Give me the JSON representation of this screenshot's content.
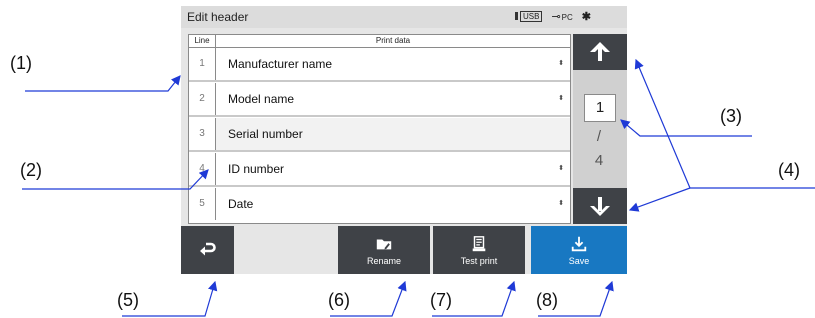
{
  "window": {
    "title": "Edit header"
  },
  "status_icons": {
    "usb_label": "USB",
    "pc_label": "PC",
    "bluetooth_glyph": "✱",
    "icons": [
      "usb-icon",
      "pc-connection-icon",
      "bluetooth-icon"
    ]
  },
  "table": {
    "headers": {
      "line": "Line",
      "data": "Print data"
    },
    "rows": [
      {
        "line": "1",
        "value": "Manufacturer name",
        "marker": "⬍"
      },
      {
        "line": "2",
        "value": "Model name",
        "marker": "⬍"
      },
      {
        "line": "3",
        "value": "Serial number",
        "marker": ""
      },
      {
        "line": "4",
        "value": "ID number",
        "marker": "⬍"
      },
      {
        "line": "5",
        "value": "Date",
        "marker": "⬍"
      }
    ]
  },
  "pager": {
    "current": "1",
    "separator": "/",
    "total": "4"
  },
  "toolbar": {
    "back_icon": "return-arrow-icon",
    "rename_label": "Rename",
    "test_print_label": "Test print",
    "save_label": "Save"
  },
  "callouts": {
    "c1": "(1)",
    "c2": "(2)",
    "c3": "(3)",
    "c4": "(4)",
    "c5": "(5)",
    "c6": "(6)",
    "c7": "(7)",
    "c8": "(8)"
  },
  "colors": {
    "button_dark": "#3f4247",
    "save_blue": "#1878c2",
    "pointer_blue": "#1f3ad6",
    "panel_gray": "#e6e6e6"
  }
}
